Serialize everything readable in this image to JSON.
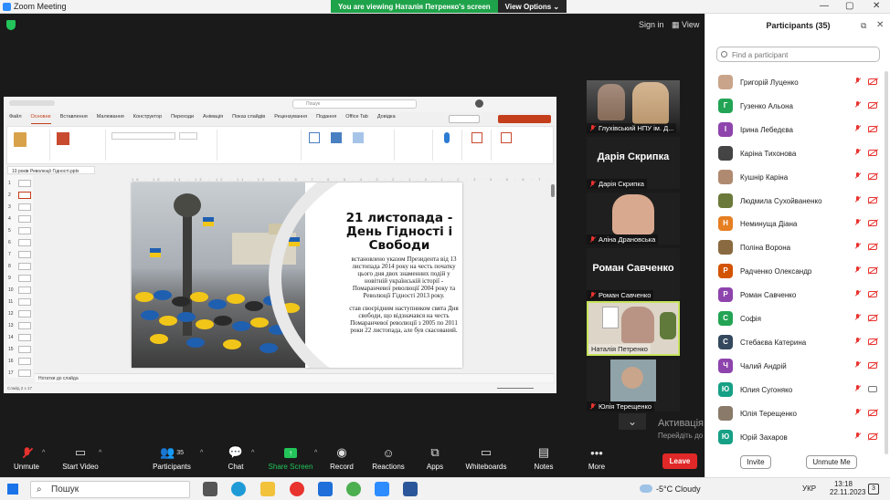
{
  "window": {
    "title": "Zoom Meeting",
    "viewing_banner": "You are viewing Наталія Петренко's screen",
    "view_options": "View Options"
  },
  "top_right": {
    "sign_in": "Sign in",
    "view": "View"
  },
  "powerpoint": {
    "search_placeholder": "Пошук",
    "tabs": [
      "Файл",
      "Основне",
      "Вставлення",
      "Малювання",
      "Конструктор",
      "Переходи",
      "Анімація",
      "Показ слайдів",
      "Рецензування",
      "Подання",
      "Office Tab",
      "Довідка"
    ],
    "active_tab": "Основне",
    "file_tab": "10 років Революції Гідності.pptx",
    "notes_label": "Нотатки до слайда",
    "status_left": "Слайд 2 з 17",
    "slide": {
      "title": "21 листопада - День Гідності і Свободи",
      "para1": "встановлено указом Президента від 13 листопада 2014 року на честь початку цього дня двох знаменних подій у новітній українській історії - Помаранчевої революції 2004 року та Революції Гідності 2013 року.",
      "para2": "став своєрідним наступником свята Дня свободи, що відзначався на честь Помаранчевої революції з 2005 по 2011 роки 22 листопада, але був скасований."
    }
  },
  "gallery": [
    {
      "name": "Глухівський НПУ ім. Д...",
      "big": ""
    },
    {
      "name": "Дарія Скрипка",
      "big": "Дарія Скрипка"
    },
    {
      "name": "Аліна Драновська",
      "big": ""
    },
    {
      "name": "Роман Савченко",
      "big": "Роман Савченко"
    },
    {
      "name": "Наталія Петренко",
      "big": ""
    },
    {
      "name": "Юлія Терещенко",
      "big": ""
    }
  ],
  "toolbar": {
    "unmute": "Unmute",
    "start_video": "Start Video",
    "participants": "Participants",
    "participants_count": "35",
    "chat": "Chat",
    "share_screen": "Share Screen",
    "record": "Record",
    "reactions": "Reactions",
    "apps": "Apps",
    "whiteboards": "Whiteboards",
    "notes": "Notes",
    "more": "More",
    "leave": "Leave"
  },
  "activation": {
    "line1": "Активація Windows",
    "line2": "Перейдіть до параметрів, щоб активувати Windows."
  },
  "participants_panel": {
    "title": "Participants (35)",
    "search_placeholder": "Find a participant",
    "invite": "Invite",
    "unmute_me": "Unmute Me",
    "people": [
      {
        "name": "Григорій Луценко",
        "initial": "",
        "color": "#c9a48a",
        "cam": false
      },
      {
        "name": "Гузенко Альона",
        "initial": "Г",
        "color": "#23a455",
        "cam": false
      },
      {
        "name": "Ірина Лебедєва",
        "initial": "І",
        "color": "#8e44ad",
        "cam": false
      },
      {
        "name": "Каріна Тихонова",
        "initial": "",
        "color": "#444444",
        "cam": false
      },
      {
        "name": "Кушнір Каріна",
        "initial": "",
        "color": "#b08a70",
        "cam": false
      },
      {
        "name": "Людмила Сухойваненко",
        "initial": "",
        "color": "#6b7a3a",
        "cam": false
      },
      {
        "name": "Неминуща Діана",
        "initial": "Н",
        "color": "#e67e22",
        "cam": false
      },
      {
        "name": "Поліна Ворона",
        "initial": "",
        "color": "#8a6a40",
        "cam": false
      },
      {
        "name": "Радченко Олександр",
        "initial": "Р",
        "color": "#d35400",
        "cam": false
      },
      {
        "name": "Роман Савченко",
        "initial": "Р",
        "color": "#8e44ad",
        "cam": false
      },
      {
        "name": "Софія",
        "initial": "С",
        "color": "#23a455",
        "cam": false
      },
      {
        "name": "Стебаєва Катерина",
        "initial": "С",
        "color": "#34495e",
        "cam": false
      },
      {
        "name": "Чалий Андрій",
        "initial": "Ч",
        "color": "#8e44ad",
        "cam": false
      },
      {
        "name": "Юлия Сугоняко",
        "initial": "Ю",
        "color": "#16a085",
        "cam": true
      },
      {
        "name": "Юлія Терещенко",
        "initial": "",
        "color": "#8a7a6a",
        "cam": false
      },
      {
        "name": "Юрій Захаров",
        "initial": "Ю",
        "color": "#16a085",
        "cam": false
      }
    ]
  },
  "taskbar": {
    "search": "Пошук",
    "weather": "-5°C  Cloudy",
    "lang": "УКР",
    "time": "13:18",
    "date": "22.11.2023",
    "notif": "3"
  },
  "colors": {
    "zoom_blue": "#2d8cff",
    "viewing_green": "#1fa34a",
    "leave_red": "#e02828",
    "active_speaker": "#c6e35a"
  }
}
